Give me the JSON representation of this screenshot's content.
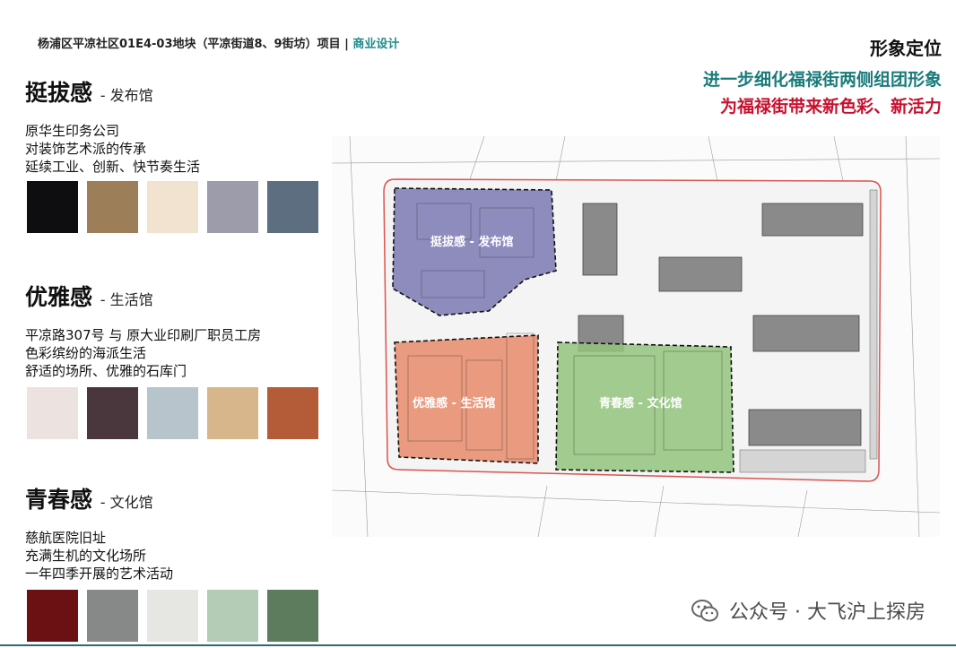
{
  "header": {
    "project": "杨浦区平凉社区01E4-03地块（平凉街道8、9街坊）项目",
    "separator": "|",
    "tag": "商业设计"
  },
  "title": {
    "main": "形象定位",
    "line1": "进一步细化福禄街两侧组团形象",
    "line2": "为福禄街带来新色彩、新活力"
  },
  "sections": [
    {
      "heading": "挺拔感",
      "subheading": "- 发布馆",
      "lines": [
        "原华生印务公司",
        "对装饰艺术派的传承",
        "延续工业、创新、快节奏生活"
      ],
      "colors": [
        "#0e0e10",
        "#9c7e58",
        "#f2e3d0",
        "#9c9cab",
        "#5c6e80"
      ]
    },
    {
      "heading": "优雅感",
      "subheading": "- 生活馆",
      "lines": [
        "平凉路307号 与 原大业印刷厂职员工房",
        "色彩缤纷的海派生活",
        "舒适的场所、优雅的石库门"
      ],
      "colors": [
        "#ece2df",
        "#4a363d",
        "#b7c4cc",
        "#d7b68c",
        "#b35c37"
      ]
    },
    {
      "heading": "青春感",
      "subheading": "- 文化馆",
      "lines": [
        "慈航医院旧址",
        "充满生机的文化场所",
        "一年四季开展的艺术活动"
      ],
      "colors": [
        "#6b1114",
        "#878988",
        "#e6e7e3",
        "#b4cbb5",
        "#5d7b5d"
      ]
    }
  ],
  "plan": {
    "zones": [
      {
        "label": "挺拔感 - 发布馆",
        "color": "#7b79b3"
      },
      {
        "label": "优雅感 - 生活馆",
        "color": "#e8896a"
      },
      {
        "label": "青春感 - 文化馆",
        "color": "#93c47d"
      }
    ]
  },
  "watermark": {
    "text": "公众号 · 大飞沪上探房",
    "icon": "wechat-icon"
  }
}
